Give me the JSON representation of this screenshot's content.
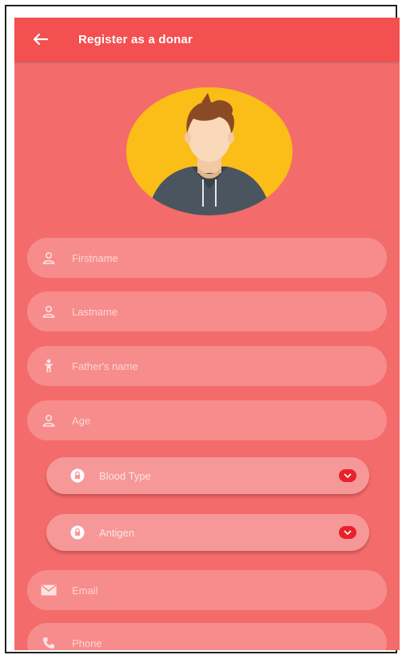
{
  "appbar": {
    "title": "Register as a donar",
    "back_icon": "arrow-left-icon"
  },
  "colors": {
    "background": "#f46b6b",
    "appbar": "#f44f51",
    "field": "#f78c8c",
    "accent": "#e8222a",
    "avatar_circle": "#fbbd17"
  },
  "form": {
    "firstname": {
      "placeholder": "Firstname",
      "icon": "person-icon"
    },
    "lastname": {
      "placeholder": "Lastname",
      "icon": "person-icon"
    },
    "fathers_name": {
      "placeholder": "Father's name",
      "icon": "man-icon"
    },
    "age": {
      "placeholder": "Age",
      "icon": "person-icon"
    },
    "blood_type": {
      "label": "Blood Type",
      "icon": "lock-icon"
    },
    "antigen": {
      "label": "Antigen",
      "icon": "lock-icon"
    },
    "email": {
      "placeholder": "Email",
      "icon": "envelope-icon"
    },
    "phone": {
      "placeholder": "Phone",
      "icon": "phone-icon"
    }
  }
}
